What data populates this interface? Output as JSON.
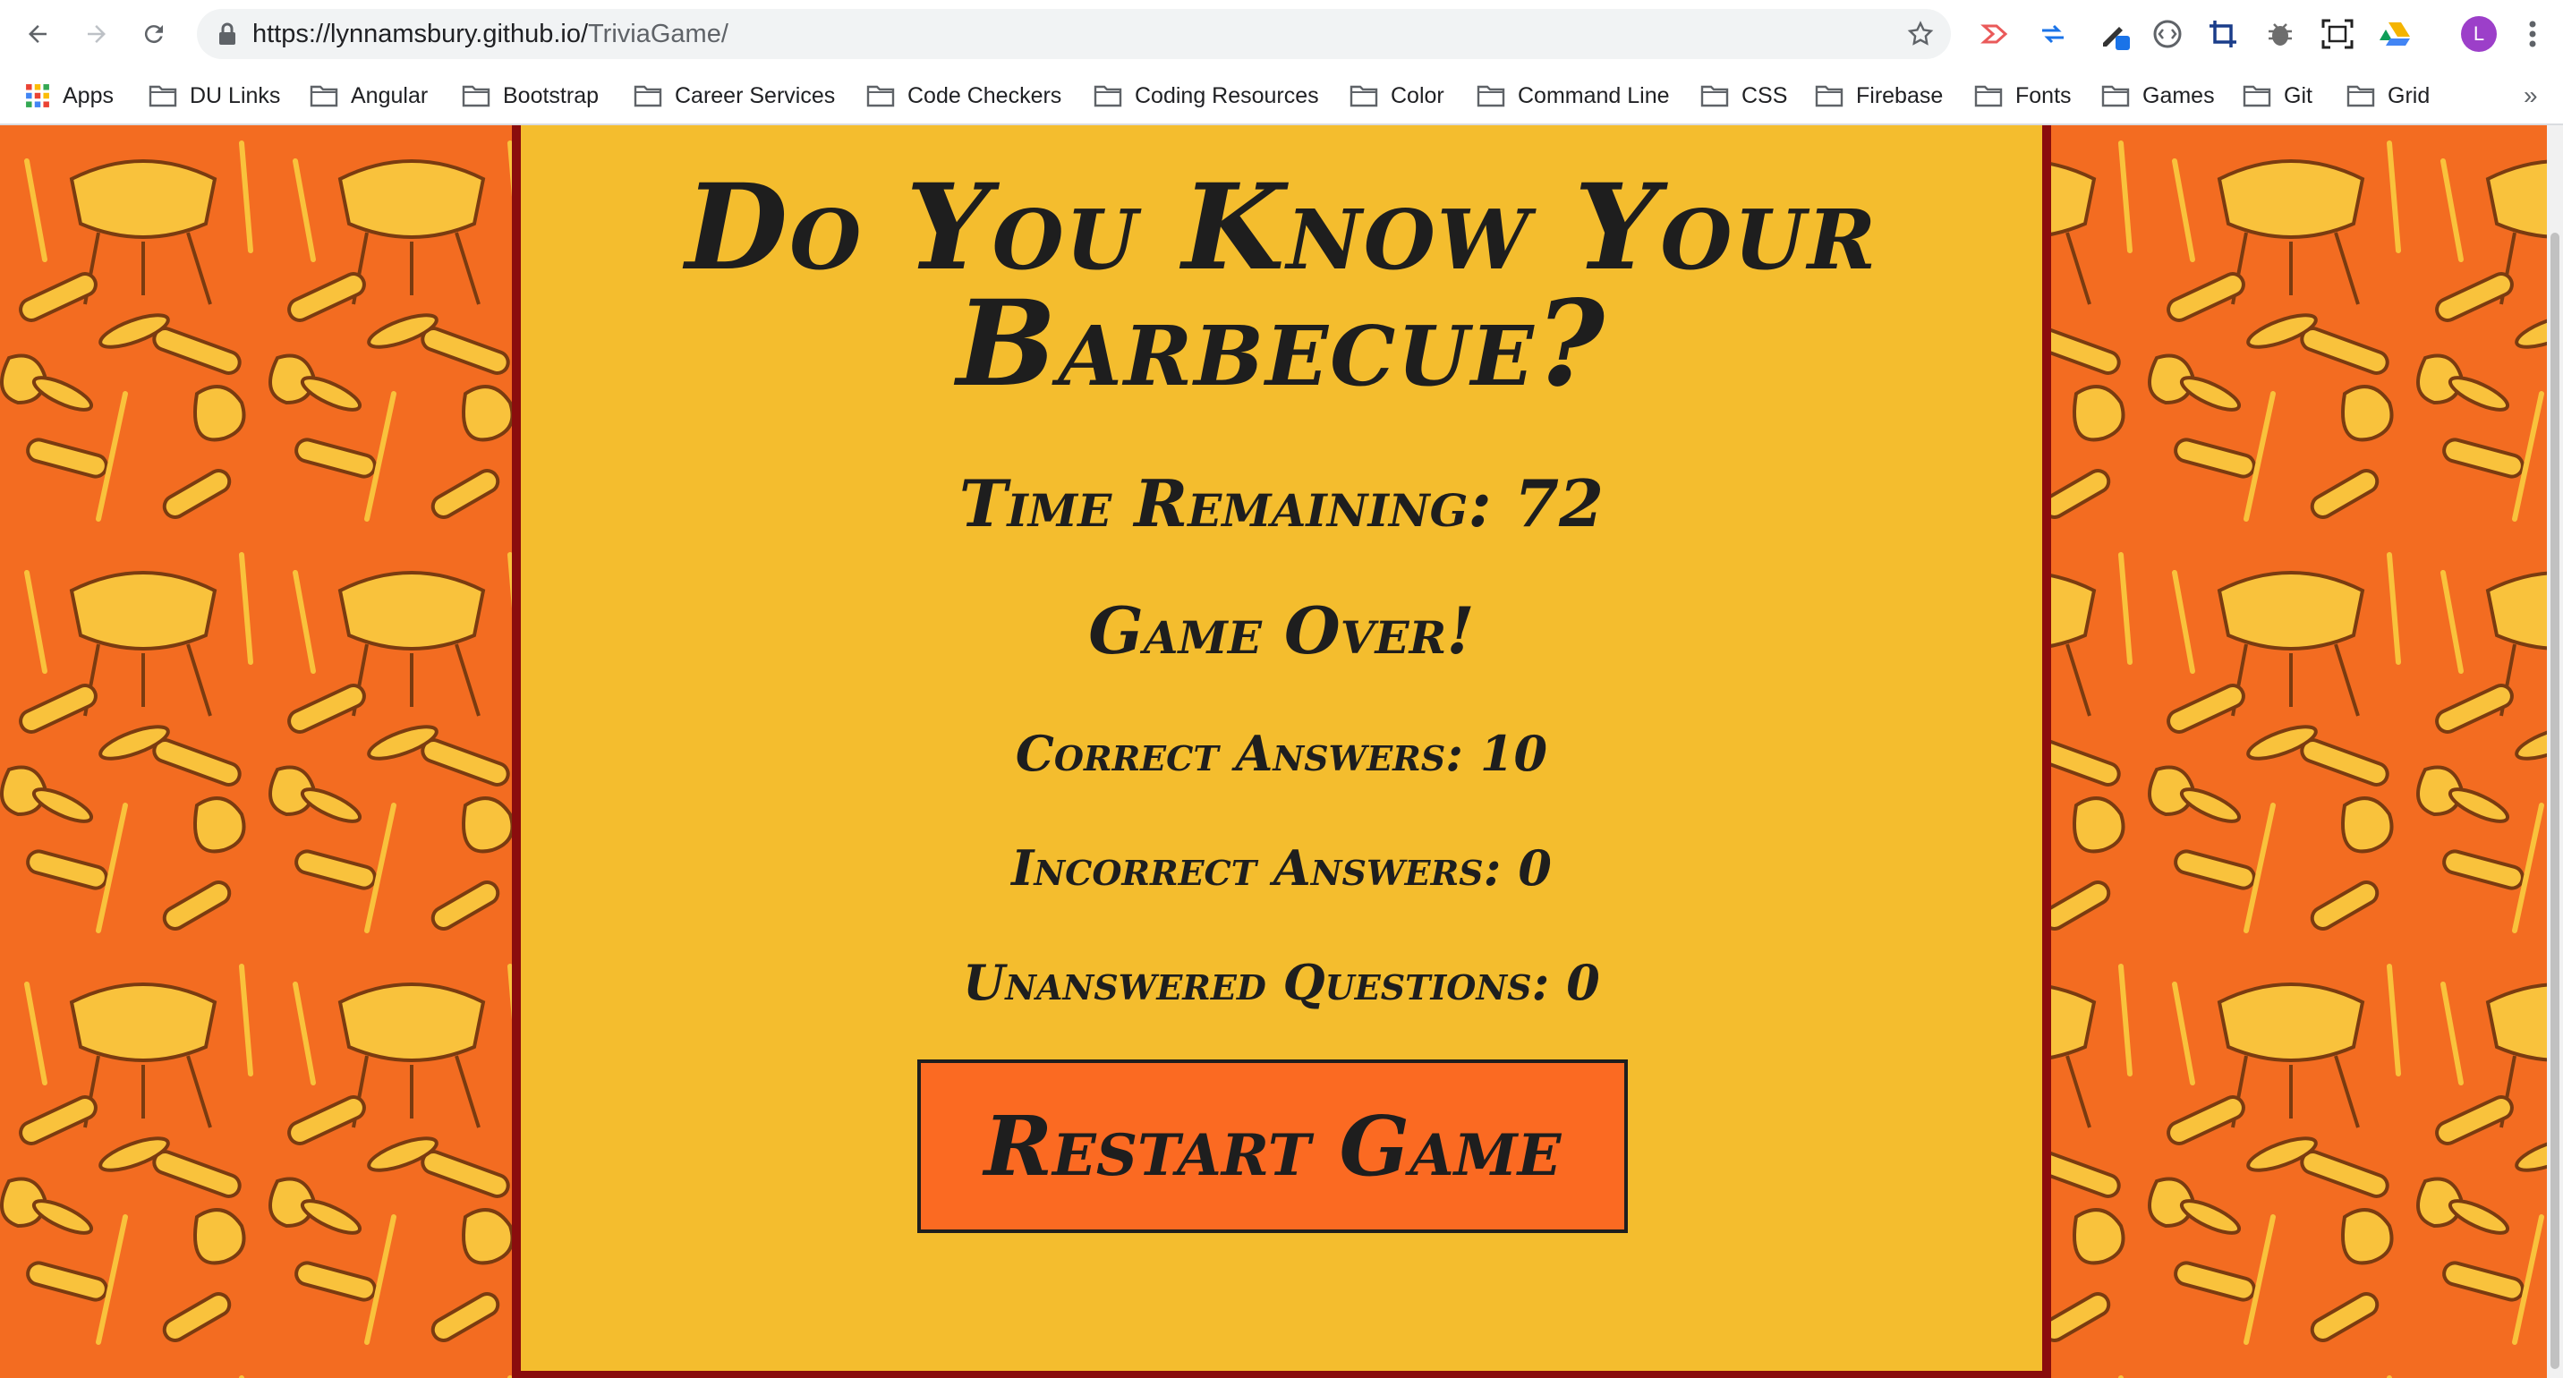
{
  "browser": {
    "url_host": "https://lynnamsbury.github.io/",
    "url_path": "TriviaGame/",
    "avatar_letter": "L",
    "bookmarks_overflow": "»",
    "bookmarks": [
      {
        "label": "Apps",
        "icon": "apps-grid-icon"
      },
      {
        "label": "DU Links",
        "icon": "folder-icon"
      },
      {
        "label": "Angular",
        "icon": "folder-icon"
      },
      {
        "label": "Bootstrap",
        "icon": "folder-icon"
      },
      {
        "label": "Career Services",
        "icon": "folder-icon"
      },
      {
        "label": "Code Checkers",
        "icon": "folder-icon"
      },
      {
        "label": "Coding Resources",
        "icon": "folder-icon"
      },
      {
        "label": "Color",
        "icon": "folder-icon"
      },
      {
        "label": "Command Line",
        "icon": "folder-icon"
      },
      {
        "label": "CSS",
        "icon": "folder-icon"
      },
      {
        "label": "Firebase",
        "icon": "folder-icon"
      },
      {
        "label": "Fonts",
        "icon": "folder-icon"
      },
      {
        "label": "Games",
        "icon": "folder-icon"
      },
      {
        "label": "Git",
        "icon": "folder-icon"
      },
      {
        "label": "Grid",
        "icon": "folder-icon"
      }
    ]
  },
  "game": {
    "title": "Do You Know Your Barbecue?",
    "time_remaining": "Time Remaining: 72",
    "status": "Game Over!",
    "correct": "Correct Answers: 10",
    "incorrect": "Incorrect Answers: 0",
    "unanswered": "Unanswered Questions: 0",
    "restart_label": "Restart Game"
  },
  "colors": {
    "panel": "#f4bd2e",
    "background_pattern": "#f36c21",
    "border": "#8a0d0d",
    "button": "#fb6a22",
    "text": "#1e1e1e"
  }
}
